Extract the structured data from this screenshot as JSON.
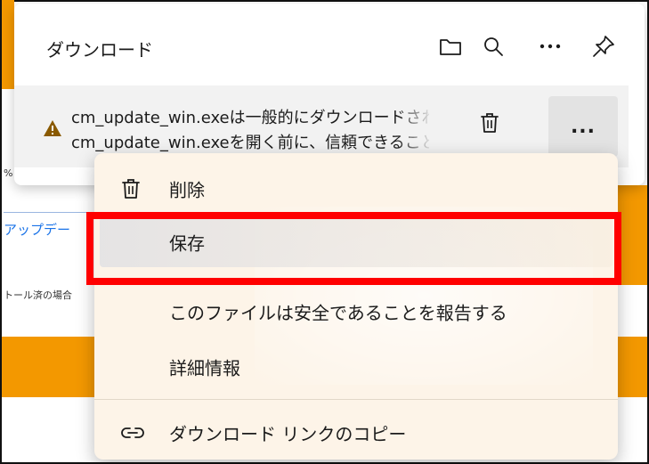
{
  "window": {
    "title": "ダウンロード"
  },
  "header_icons": [
    "folder-icon",
    "search-icon",
    "more-icon",
    "pin-icon"
  ],
  "download_item": {
    "line1": "cm_update_win.exeは一般的にダウンロードされていません",
    "line2": "cm_update_win.exeを開く前に、信頼できることを確認してください",
    "more_label": "..."
  },
  "menu": {
    "items": [
      {
        "label": "削除",
        "icon": "trash-icon"
      },
      {
        "label": "保存",
        "icon": ""
      },
      {
        "label": "このファイルは安全であることを報告する",
        "icon": ""
      },
      {
        "label": "詳細情報",
        "icon": ""
      },
      {
        "label": "ダウンロード リンクのコピー",
        "icon": "link-icon"
      }
    ],
    "highlighted": "保存"
  },
  "background": {
    "link_text": "アップデー",
    "small_text": "トール済の場合",
    "mark_text": "%"
  },
  "colors": {
    "accent_orange": "#f39800",
    "highlight_red": "#ff0000",
    "warning_brown": "#8a5a00"
  }
}
